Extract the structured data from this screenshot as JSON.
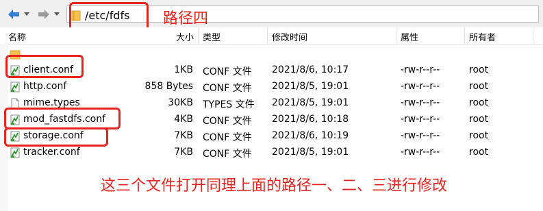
{
  "address": {
    "path": "/etc/fdfs"
  },
  "annotations": {
    "path_label": "路径四",
    "note": "这三个文件打开同理上面的路径一、二、三进行修改"
  },
  "columns": {
    "name": "名称",
    "size": "大小",
    "type": "类型",
    "modified": "修改时间",
    "attributes": "属性",
    "owner": "所有者"
  },
  "rows": [
    {
      "name": "..",
      "size": "",
      "type": "",
      "modified": "",
      "attributes": "",
      "owner": "",
      "icon": "parent-folder-icon"
    },
    {
      "name": "client.conf",
      "size": "1KB",
      "type": "CONF 文件",
      "modified": "2021/8/6, 10:17",
      "attributes": "-rw-r--r--",
      "owner": "root",
      "icon": "conf-file-icon"
    },
    {
      "name": "http.conf",
      "size": "858 Bytes",
      "type": "CONF 文件",
      "modified": "2021/8/5, 19:01",
      "attributes": "-rw-r--r--",
      "owner": "root",
      "icon": "conf-file-icon"
    },
    {
      "name": "mime.types",
      "size": "30KB",
      "type": "TYPES 文件",
      "modified": "2021/8/5, 19:01",
      "attributes": "-rw-r--r--",
      "owner": "root",
      "icon": "generic-file-icon"
    },
    {
      "name": "mod_fastdfs.conf",
      "size": "4KB",
      "type": "CONF 文件",
      "modified": "2021/8/6, 10:18",
      "attributes": "-rw-r--r--",
      "owner": "root",
      "icon": "conf-file-icon"
    },
    {
      "name": "storage.conf",
      "size": "7KB",
      "type": "CONF 文件",
      "modified": "2021/8/6, 10:19",
      "attributes": "-rw-r--r--",
      "owner": "root",
      "icon": "conf-file-icon"
    },
    {
      "name": "tracker.conf",
      "size": "7KB",
      "type": "CONF 文件",
      "modified": "2021/8/5, 19:01",
      "attributes": "-rw-r--r--",
      "owner": "root",
      "icon": "conf-file-icon"
    }
  ],
  "colors": {
    "annotation_red": "#e8231f",
    "nav_blue": "#2f7fd6"
  }
}
